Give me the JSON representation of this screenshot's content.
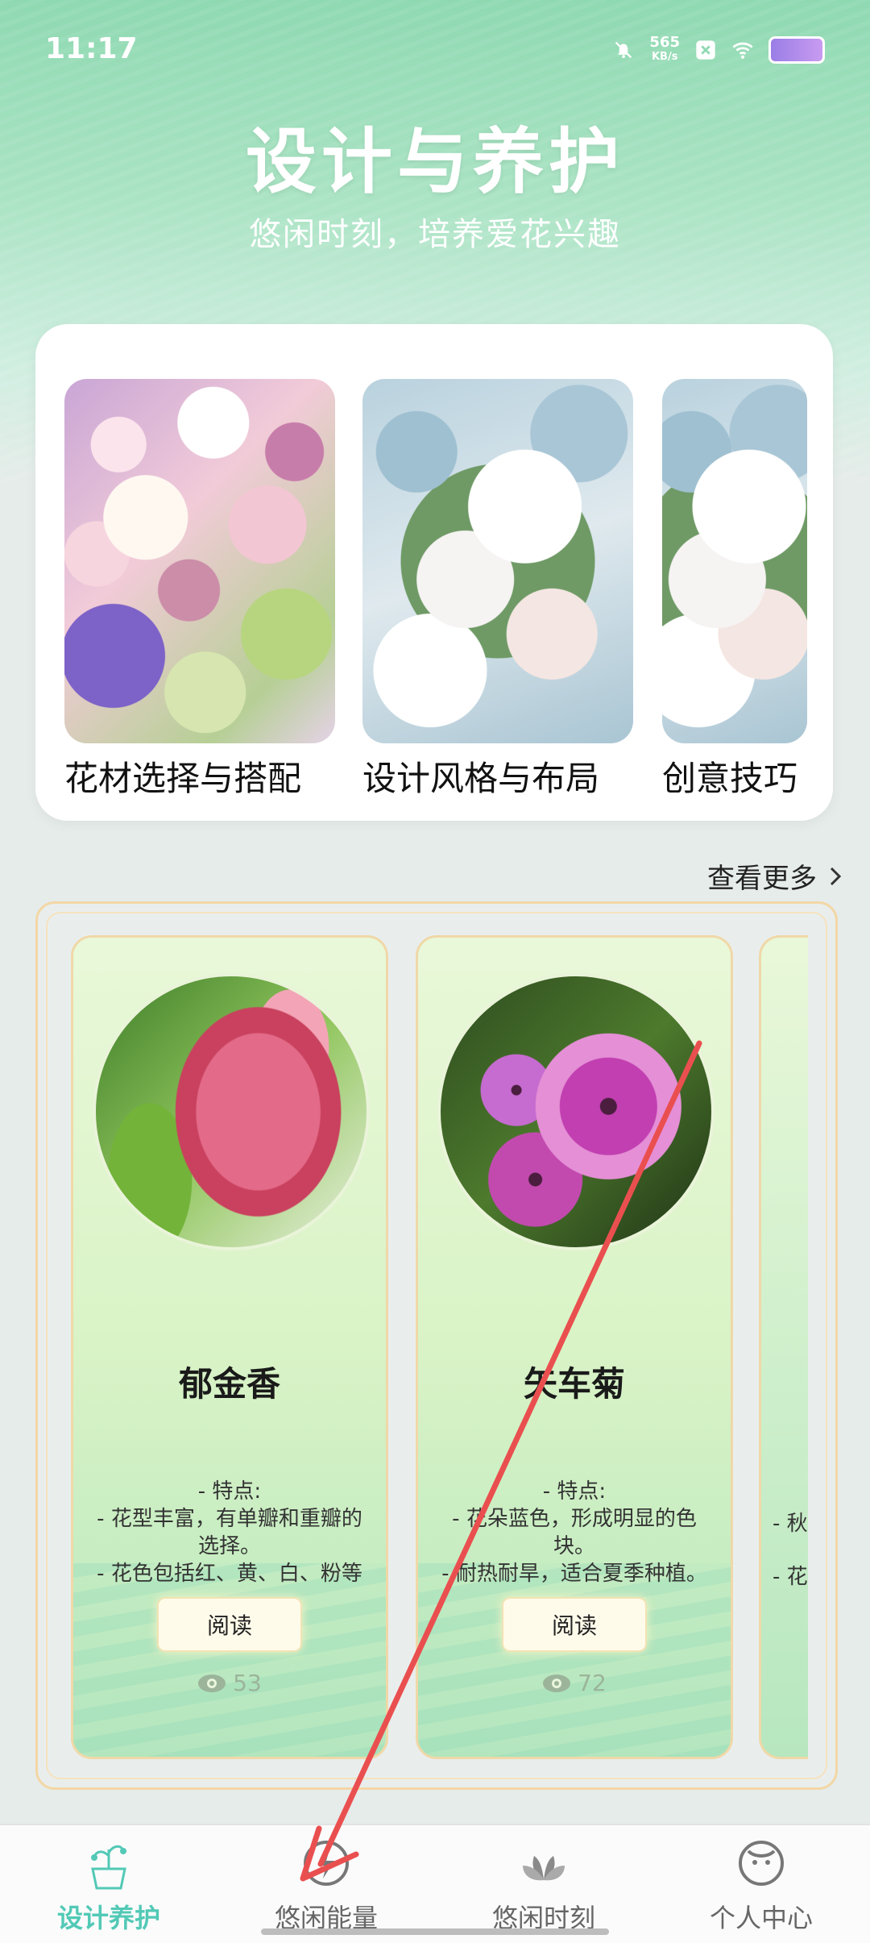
{
  "status": {
    "time": "11:17",
    "net_speed_value": "565",
    "net_speed_unit": "KB/s",
    "icons": [
      "mute-bell-icon",
      "close-badge-icon",
      "wifi-icon",
      "battery-icon"
    ]
  },
  "hero": {
    "title": "设计与养护",
    "subtitle": "悠闲时刻，培养爱花兴趣"
  },
  "categories": [
    {
      "label": "花材选择与搭配"
    },
    {
      "label": "设计风格与布局"
    },
    {
      "label": "创意技巧"
    }
  ],
  "more_label": "查看更多",
  "flowers": [
    {
      "name": "郁金香",
      "features_title": "- 特点:",
      "features": [
        "- 花型丰富，有单瓣和重瓣的",
        "选择。",
        "- 花色包括红、黄、白、粉等"
      ],
      "read_label": "阅读",
      "views": "53"
    },
    {
      "name": "矢车菊",
      "features_title": "- 特点:",
      "features": [
        "- 花朵蓝色，形成明显的色",
        "块。",
        "- 耐热耐旱，适合夏季种植。"
      ],
      "read_label": "阅读",
      "views": "72"
    }
  ],
  "peek_card": {
    "line1": "- 秋",
    "line2": "- 花"
  },
  "nav": [
    {
      "label": "设计养护",
      "icon": "plant-pot-icon",
      "active": true
    },
    {
      "label": "悠闲能量",
      "icon": "lightning-icon",
      "active": false
    },
    {
      "label": "悠闲时刻",
      "icon": "lotus-icon",
      "active": false
    },
    {
      "label": "个人中心",
      "icon": "face-icon",
      "active": false
    }
  ],
  "colors": {
    "accent": "#52c9b6",
    "hero_bg": "#a9e3c3",
    "card_gold_border": "#f0d8a8",
    "annotation_arrow": "#ea4f4f"
  }
}
